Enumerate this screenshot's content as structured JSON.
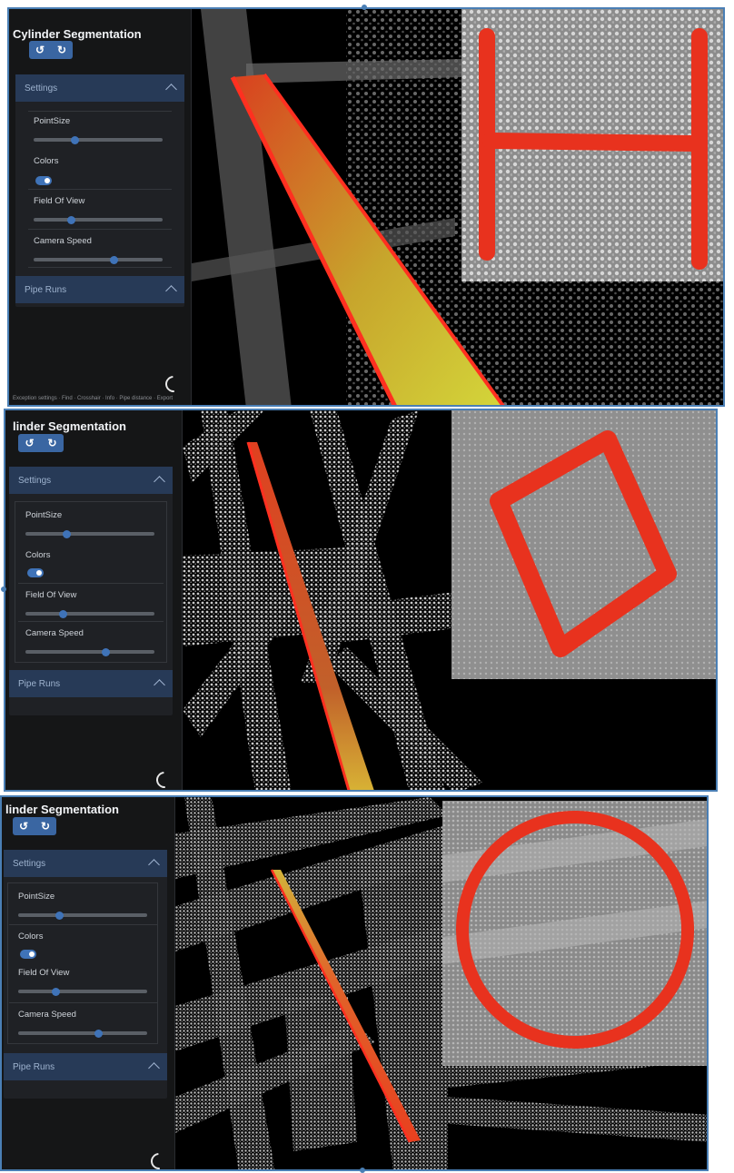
{
  "panels": [
    {
      "title": "Cylinder Segmentation",
      "undo_glyph": "↺",
      "redo_glyph": "↻",
      "settings_header": "Settings",
      "settings": [
        {
          "label": "PointSize",
          "type": "slider",
          "value": 0.32
        },
        {
          "label": "Colors",
          "type": "toggle",
          "value": true
        },
        {
          "label": "Field Of View",
          "type": "slider",
          "value": 0.29
        },
        {
          "label": "Camera Speed",
          "type": "slider",
          "value": 0.62
        }
      ],
      "pipe_runs_header": "Pipe Runs",
      "inset_shape": "H-beam",
      "status_text": "Exception settings · Find · Crosshair · Info · Pipe distance · Export"
    },
    {
      "title": "linder Segmentation",
      "undo_glyph": "↺",
      "redo_glyph": "↻",
      "settings_header": "Settings",
      "settings": [
        {
          "label": "PointSize",
          "type": "slider",
          "value": 0.32
        },
        {
          "label": "Colors",
          "type": "toggle",
          "value": true
        },
        {
          "label": "Field Of View",
          "type": "slider",
          "value": 0.29
        },
        {
          "label": "Camera Speed",
          "type": "slider",
          "value": 0.62
        }
      ],
      "pipe_runs_header": "Pipe Runs",
      "inset_shape": "square"
    },
    {
      "title": "linder Segmentation",
      "undo_glyph": "↺",
      "redo_glyph": "↻",
      "settings_header": "Settings",
      "settings": [
        {
          "label": "PointSize",
          "type": "slider",
          "value": 0.32
        },
        {
          "label": "Colors",
          "type": "toggle",
          "value": true
        },
        {
          "label": "Field Of View",
          "type": "slider",
          "value": 0.29
        },
        {
          "label": "Camera Speed",
          "type": "slider",
          "value": 0.62
        }
      ],
      "pipe_runs_header": "Pipe Runs",
      "inset_shape": "circle"
    }
  ],
  "colors": {
    "accent": "#3f73b8",
    "header": "#273a57",
    "segment_red": "#e8321e",
    "segment_yellow": "#c9d422",
    "frame": "#4a7fb5"
  }
}
